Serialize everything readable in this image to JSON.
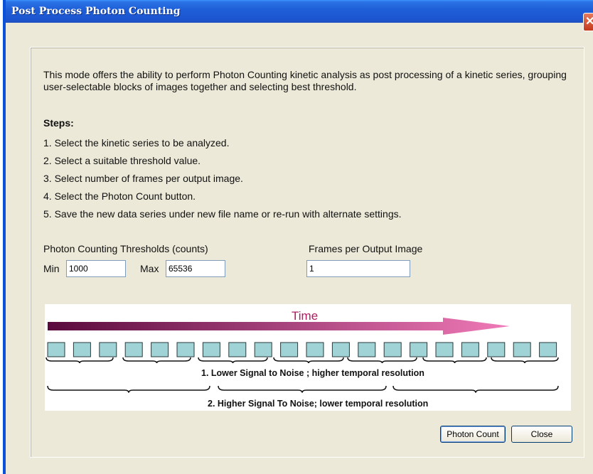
{
  "window": {
    "title": "Post Process Photon Counting",
    "close_glyph": "✕"
  },
  "description": "This mode offers the ability to perform Photon Counting kinetic analysis as post processing of a kinetic series, grouping user-selectable blocks of images together and selecting best threshold.",
  "steps": {
    "title": "Steps:",
    "items": [
      "1. Select the kinetic series to be analyzed.",
      "2. Select a suitable threshold value.",
      "3. Select number of frames per output image.",
      "4. Select the Photon Count button.",
      "5. Save the new data series under new file name or re-run with alternate settings."
    ]
  },
  "thresholds": {
    "label": "Photon Counting Thresholds (counts)",
    "min_label": "Min",
    "min_value": "1000",
    "max_label": "Max",
    "max_value": "65536"
  },
  "frames": {
    "label": "Frames per Output Image",
    "value": "1"
  },
  "diagram": {
    "time_label": "Time",
    "caption_1": "1. Lower Signal to Noise ; higher temporal resolution",
    "caption_2": "2. Higher Signal To Noise; lower temporal resolution",
    "arrow_color_start": "#5a0a3e",
    "arrow_color_end": "#f07ab8",
    "frame_fill": "#9fd3d6",
    "frame_count": 20
  },
  "buttons": {
    "photon_count": "Photon Count",
    "close": "Close"
  }
}
